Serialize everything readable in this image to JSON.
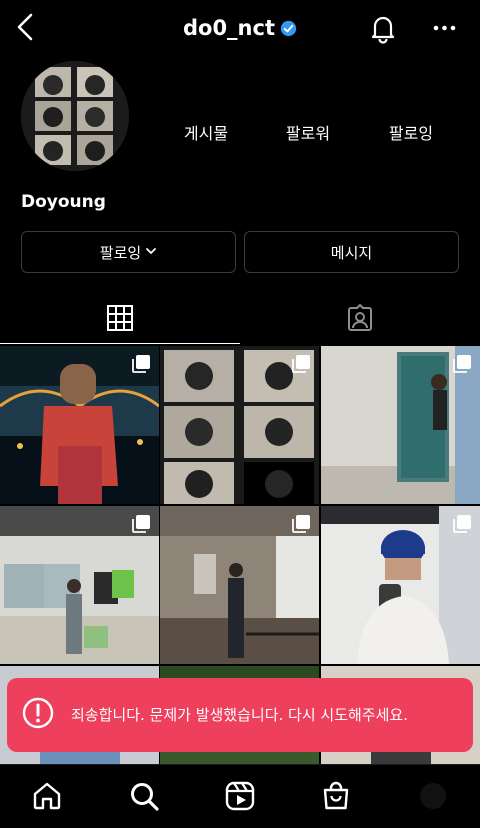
{
  "header": {
    "username": "do0_nct",
    "back_icon": "chevron-left-icon",
    "verified_icon": "verified-badge-icon",
    "notification_icon": "bell-icon",
    "more_icon": "more-horizontal-icon",
    "verified_color": "#3897f0"
  },
  "profile": {
    "display_name": "Doyoung",
    "stats": [
      {
        "label": "게시물"
      },
      {
        "label": "팔로워"
      },
      {
        "label": "팔로잉"
      }
    ]
  },
  "actions": {
    "following_label": "팔로잉",
    "message_label": "메시지"
  },
  "tabs": [
    {
      "name": "posts",
      "icon": "grid-icon",
      "active": true
    },
    {
      "name": "tagged",
      "icon": "tagged-icon",
      "active": false
    }
  ],
  "posts": [
    {
      "multiple": true
    },
    {
      "multiple": true
    },
    {
      "multiple": true
    },
    {
      "multiple": true
    },
    {
      "multiple": true
    },
    {
      "multiple": true
    },
    {
      "multiple": false
    },
    {
      "multiple": false
    },
    {
      "multiple": false
    }
  ],
  "toast": {
    "message": "죄송합니다. 문제가 발생했습니다. 다시 시도해주세요.",
    "icon": "alert-circle-icon",
    "color": "#ee3f5c"
  },
  "bottom_nav": [
    {
      "name": "home",
      "icon": "home-icon"
    },
    {
      "name": "search",
      "icon": "search-icon"
    },
    {
      "name": "reels",
      "icon": "reels-icon"
    },
    {
      "name": "shop",
      "icon": "shop-icon"
    },
    {
      "name": "profile",
      "icon": "profile-icon"
    }
  ]
}
